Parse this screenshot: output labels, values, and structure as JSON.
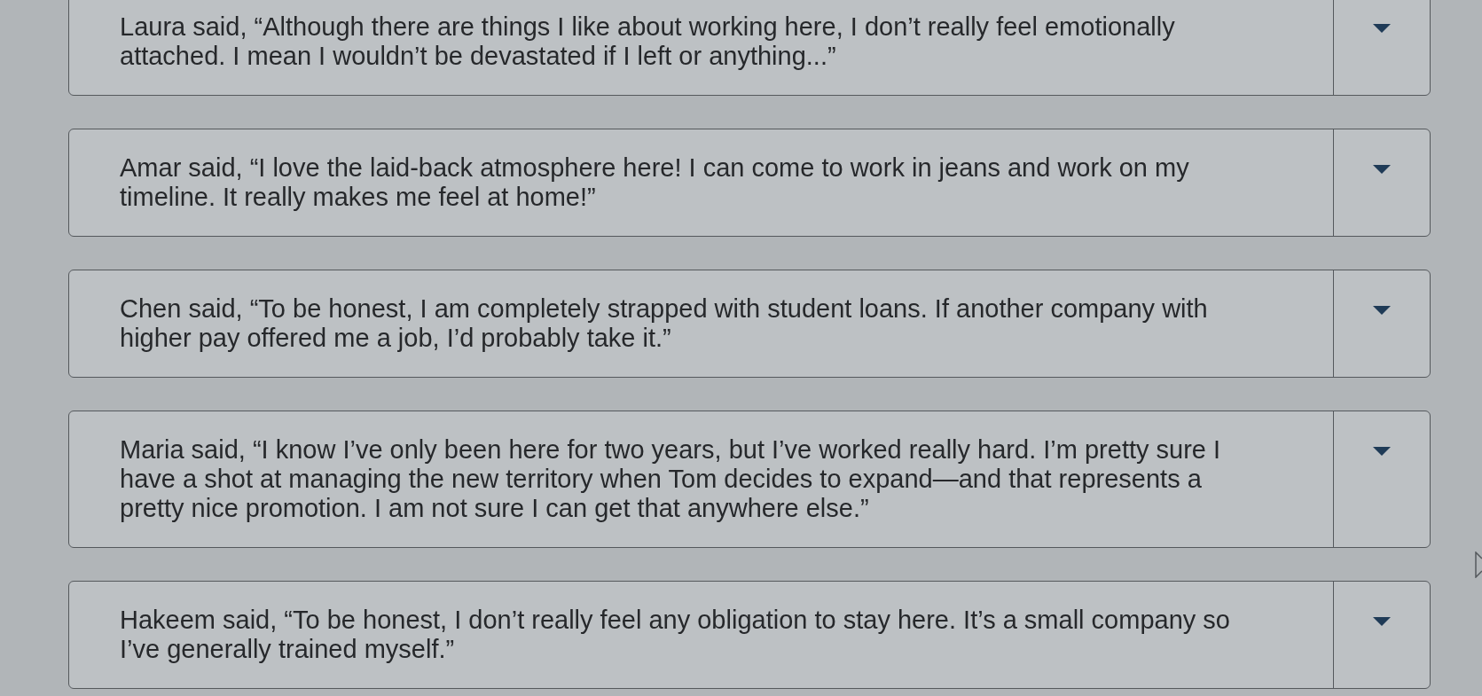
{
  "statements": [
    {
      "text": "Laura said, “Although there are things I like about working here, I don’t really feel emotionally attached. I mean I wouldn’t be devastated if I left or anything...”"
    },
    {
      "text": "Amar said, “I love the laid-back atmosphere here! I can come to work in jeans and work on my timeline. It really makes me feel at home!”"
    },
    {
      "text": "Chen said, “To be honest, I am completely strapped with student loans. If another company with higher pay offered me a job, I’d probably take it.”"
    },
    {
      "text": "Maria said, “I know I’ve only been here for two years, but I’ve worked really hard. I’m pretty sure I have a shot at managing the new territory when Tom decides to expand—and that represents a pretty nice promotion. I am not sure I can get that anywhere else.”"
    },
    {
      "text": "Hakeem said, “To be honest, I don’t really feel any obligation to stay here. It’s a small company so I’ve generally trained myself.”"
    }
  ]
}
